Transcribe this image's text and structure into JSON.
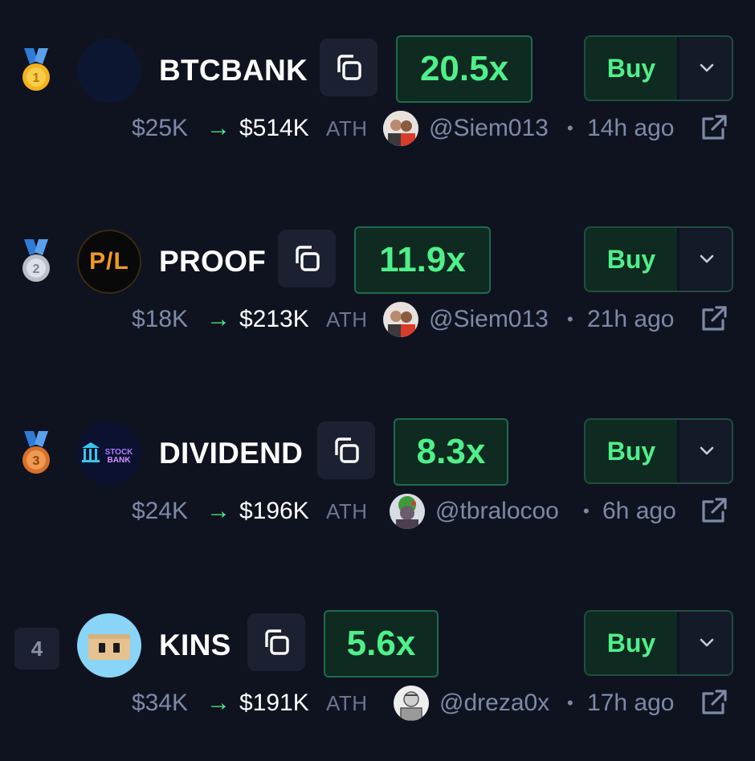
{
  "rows": [
    {
      "rank_icon": "gold-medal-icon",
      "rank_color": "#f2b31b",
      "rank_number": "1",
      "token": "BTCBANK",
      "logo_icon": "btcbank-logo",
      "multiplier": "20.5x",
      "buy_label": "Buy",
      "mc_from": "$25K",
      "arrow": "→",
      "mc_to": "$514K",
      "ath_label": "ATH",
      "handle": "@Siem013",
      "separator": "•",
      "time_ago": "14h ago"
    },
    {
      "rank_icon": "silver-medal-icon",
      "rank_color": "#c8ccd4",
      "rank_number": "2",
      "token": "PROOF",
      "logo_icon": "pl-logo",
      "logo_text": "P/L",
      "multiplier": "11.9x",
      "buy_label": "Buy",
      "mc_from": "$18K",
      "arrow": "→",
      "mc_to": "$213K",
      "ath_label": "ATH",
      "handle": "@Siem013",
      "separator": "•",
      "time_ago": "21h ago"
    },
    {
      "rank_icon": "bronze-medal-icon",
      "rank_color": "#e07c2c",
      "rank_number": "3",
      "token": "DIVIDEND",
      "logo_icon": "stockbank-logo",
      "logo_text_top": "STOCK",
      "logo_text_bottom": "BANK",
      "multiplier": "8.3x",
      "buy_label": "Buy",
      "mc_from": "$24K",
      "arrow": "→",
      "mc_to": "$196K",
      "ath_label": "ATH",
      "handle": "@tbralocoo",
      "separator": "•",
      "time_ago": "6h ago"
    },
    {
      "rank_label": "4",
      "token": "KINS",
      "logo_icon": "kins-box-logo",
      "multiplier": "5.6x",
      "buy_label": "Buy",
      "mc_from": "$34K",
      "arrow": "→",
      "mc_to": "$191K",
      "ath_label": "ATH",
      "handle": "@dreza0x",
      "separator": "•",
      "time_ago": "17h ago"
    }
  ],
  "colors": {
    "background": "#0f1320",
    "accent_green": "#4ef08a",
    "muted_text": "#7d8aa6",
    "button_bg": "#1b2130"
  }
}
